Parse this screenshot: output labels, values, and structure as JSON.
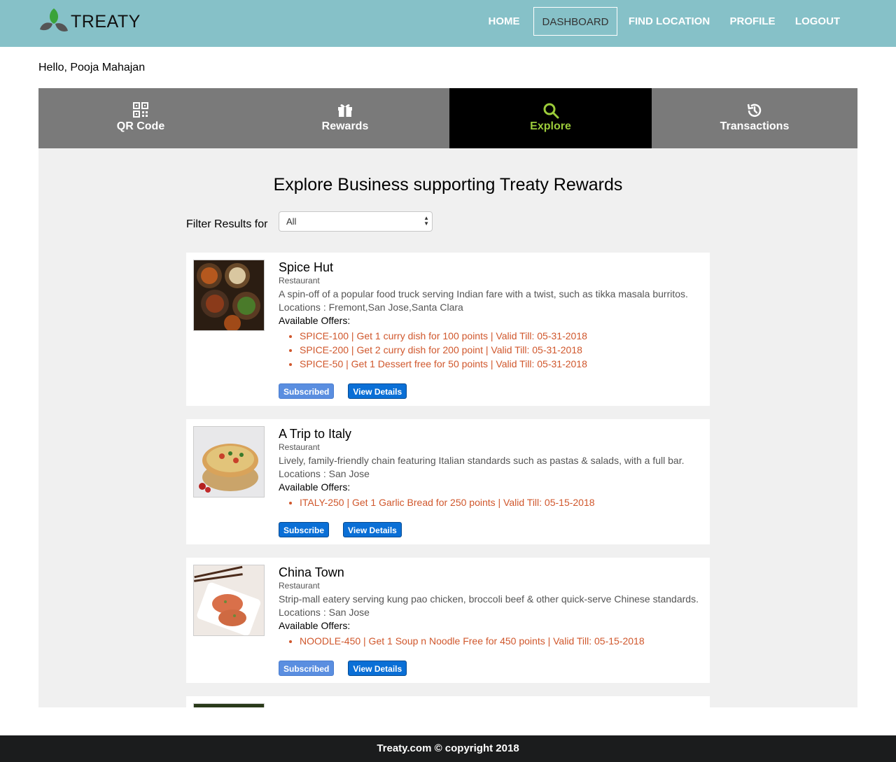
{
  "brand": {
    "name": "TREATY"
  },
  "nav": {
    "home": "HOME",
    "dashboard": "DASHBOARD",
    "find_location": "FIND LOCATION",
    "profile": "PROFILE",
    "logout": "LOGOUT"
  },
  "greeting": "Hello, Pooja Mahajan",
  "tabs": [
    {
      "label": "QR Code",
      "icon": "qr-code-icon"
    },
    {
      "label": "Rewards",
      "icon": "gift-icon"
    },
    {
      "label": "Explore",
      "icon": "search-icon"
    },
    {
      "label": "Transactions",
      "icon": "history-icon"
    }
  ],
  "explore": {
    "heading": "Explore Business supporting Treaty Rewards",
    "filter_label": "Filter Results for",
    "filter_value": "All"
  },
  "businesses": [
    {
      "name": "Spice Hut",
      "category": "Restaurant",
      "description": "A spin-off of a popular food truck serving Indian fare with a twist, such as tikka masala burritos.",
      "locations": "Locations : Fremont,San Jose,Santa Clara",
      "offers_label": "Available Offers:",
      "offers": [
        "SPICE-100 | Get 1 curry dish for 100 points | Valid Till: 05-31-2018",
        "SPICE-200 | Get 2 curry dish for 200 point | Valid Till: 05-31-2018",
        "SPICE-50 | Get 1 Dessert free for 50 points | Valid Till: 05-31-2018"
      ],
      "subscribe_label": "Subscribed",
      "details_label": "View Details"
    },
    {
      "name": "A Trip to Italy",
      "category": "Restaurant",
      "description": "Lively, family-friendly chain featuring Italian standards such as pastas & salads, with a full bar.",
      "locations": "Locations : San Jose",
      "offers_label": "Available Offers:",
      "offers": [
        "ITALY-250 | Get 1 Garlic Bread for 250 points | Valid Till: 05-15-2018"
      ],
      "subscribe_label": "Subscribe",
      "details_label": "View Details"
    },
    {
      "name": "China Town",
      "category": "Restaurant",
      "description": "Strip-mall eatery serving kung pao chicken, broccoli beef & other quick-serve Chinese standards.",
      "locations": "Locations : San Jose",
      "offers_label": "Available Offers:",
      "offers": [
        "NOODLE-450 | Get 1 Soup n Noodle Free for 450 points | Valid Till: 05-15-2018"
      ],
      "subscribe_label": "Subscribed",
      "details_label": "View Details"
    }
  ],
  "footer": "Treaty.com © copyright 2018",
  "colors": {
    "navbar": "#86c1c8",
    "tab_bar": "#7a7a7a",
    "tab_active": "#000000",
    "tab_active_text": "#9ccc3a",
    "offer_text": "#d0572c",
    "button_primary": "#0a6fd6",
    "button_subscribed": "#5a8ee0",
    "footer": "#1b1c1d"
  }
}
